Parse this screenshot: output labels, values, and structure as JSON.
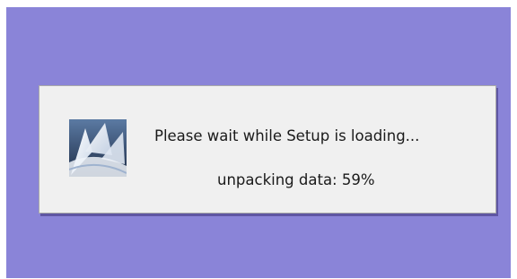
{
  "dialog": {
    "message": "Please wait while Setup is loading...",
    "status": "unpacking data: 59%",
    "progress_percent": 59,
    "logo_icon": "setup-logo-icon"
  },
  "colors": {
    "desktop_background": "#8a84d8",
    "dialog_background": "#f0f0f0"
  }
}
